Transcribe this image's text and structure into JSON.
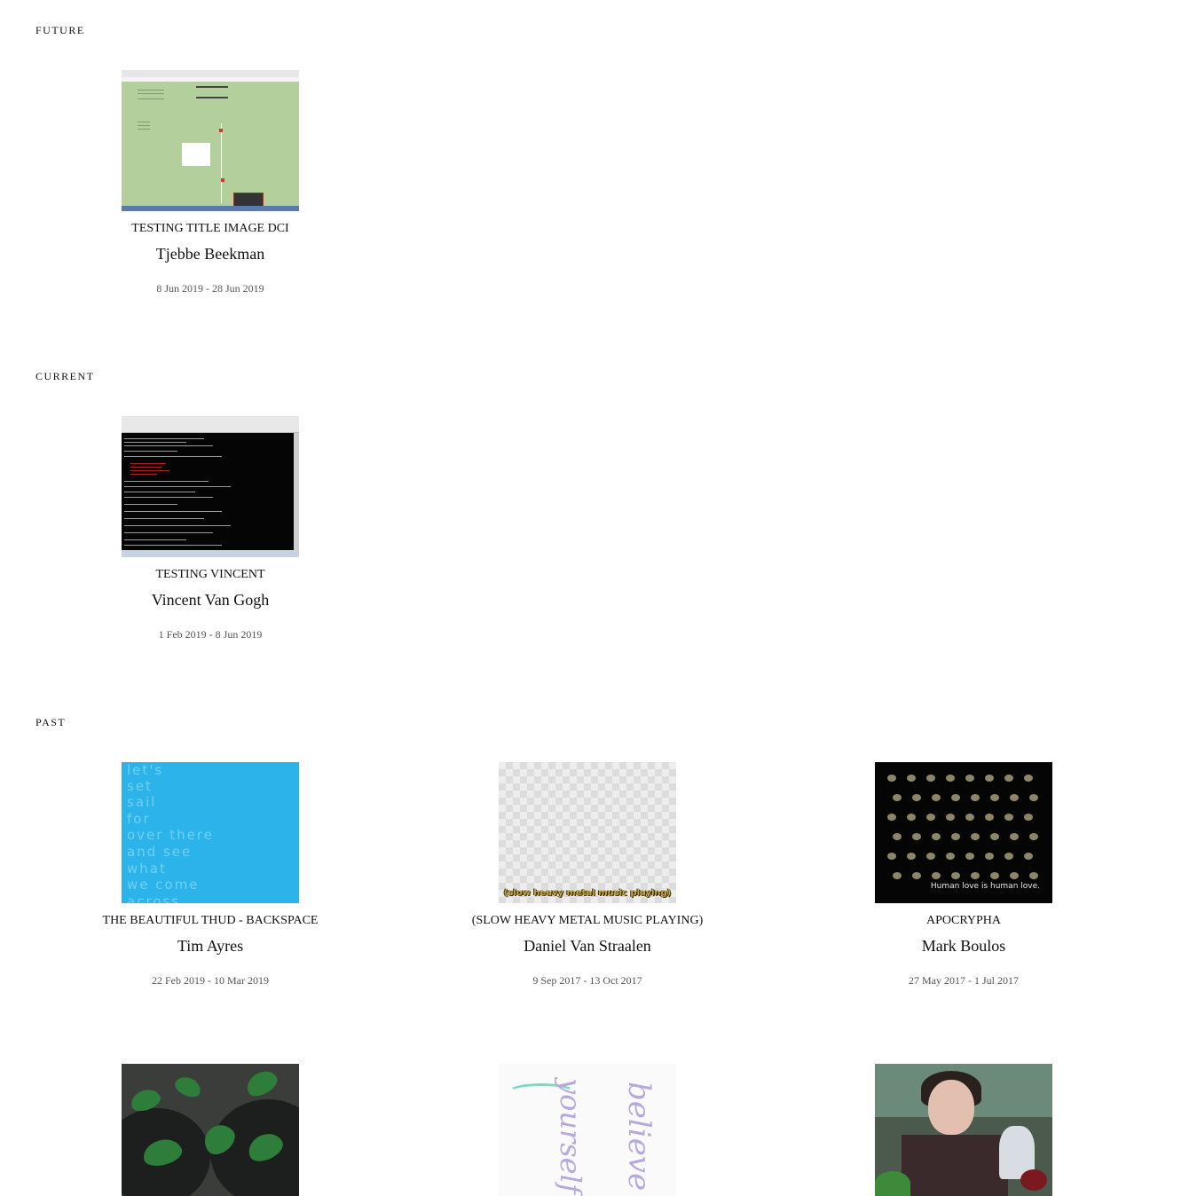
{
  "sections": {
    "future": {
      "heading": "FUTURE"
    },
    "current": {
      "heading": "CURRENT"
    },
    "past": {
      "heading": "PAST"
    }
  },
  "exhibitions": {
    "future": [
      {
        "title": "TESTING TITLE IMAGE DCI",
        "artist": "Tjebbe Beekman",
        "dates": "8 Jun 2019 - 28 Jun 2019"
      }
    ],
    "current": [
      {
        "title": "TESTING VINCENT",
        "artist": "Vincent Van Gogh",
        "dates": "1 Feb 2019 - 8 Jun 2019"
      }
    ],
    "past": [
      {
        "title": "THE BEAUTIFUL THUD - BACKSPACE",
        "artist": "Tim Ayres",
        "dates": "22 Feb 2019 - 10 Mar 2019"
      },
      {
        "title": "(SLOW HEAVY METAL MUSIC PLAYING)",
        "artist": "Daniel Van Straalen",
        "dates": "9 Sep 2017 - 13 Oct 2017"
      },
      {
        "title": "APOCRYPHA",
        "artist": "Mark Boulos",
        "dates": "27 May 2017 - 1 Jul 2017"
      }
    ]
  },
  "thumbnail_text": {
    "blue_lines": [
      "let's",
      "set",
      "sail",
      "for",
      "over there",
      "and see",
      "what",
      "we come",
      "across"
    ],
    "slow_metal_caption": "(slow heavy metal music playing)",
    "apocrypha_caption": "Human love is human love.",
    "script_words": [
      "believe in",
      "yourself"
    ]
  },
  "colors": {
    "text": "#111111",
    "dates": "#555555",
    "background": "#ffffff"
  }
}
